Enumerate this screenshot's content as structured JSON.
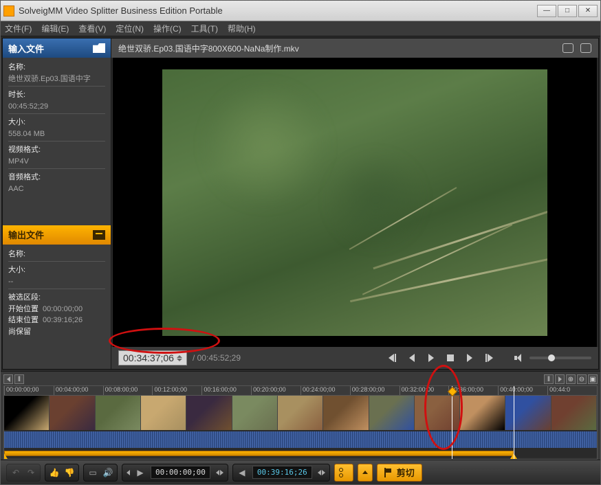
{
  "window": {
    "title": "SolveigMM Video Splitter Business Edition Portable"
  },
  "menu": {
    "file": "文件(F)",
    "edit": "编辑(E)",
    "view": "查看(V)",
    "locate": "定位(N)",
    "control": "操作(C)",
    "tools": "工具(T)",
    "help": "帮助(H)"
  },
  "sidebar": {
    "input_header": "输入文件",
    "name_label": "名称:",
    "name_value": "绝世双骄.Ep03.国语中字",
    "duration_label": "时长:",
    "duration_value": "00:45:52;29",
    "size_label": "大小:",
    "size_value": "558.04 MB",
    "vformat_label": "视频格式:",
    "vformat_value": "MP4V",
    "aformat_label": "音频格式:",
    "aformat_value": "AAC",
    "output_header": "输出文件",
    "out_name_label": "名称:",
    "out_size_label": "大小:",
    "out_size_value": "--",
    "segment_label": "被选区段:",
    "start_label": "开始位置",
    "start_value": "00:00:00;00",
    "end_label": "结束位置",
    "end_value": "00:39:16;26",
    "keep_label": "尚保留"
  },
  "video": {
    "filename": "绝世双骄.Ep03.国语中字800X600-NaNa制作.mkv",
    "current_time": "00:34:37;06",
    "total_time": "/ 00:45:52;29",
    "volume_percent": 30
  },
  "timeline": {
    "ticks": [
      "00:00:00;00",
      "00:04:00;00",
      "00:08:00;00",
      "00:12:00;00",
      "00:16:00;00",
      "00:20:00;00",
      "00:24:00;00",
      "00:28:00;00",
      "00:32:00;00",
      "00:36:00;00",
      "00:40:00;00",
      "00:44:0"
    ],
    "range_start_pct": 0,
    "range_end_pct": 86,
    "playhead_pct": 75.5,
    "marker2_pct": 86
  },
  "bottom": {
    "time1": "00:00:00;00",
    "time2": "00:39:16;26",
    "cut_label": "剪切"
  }
}
